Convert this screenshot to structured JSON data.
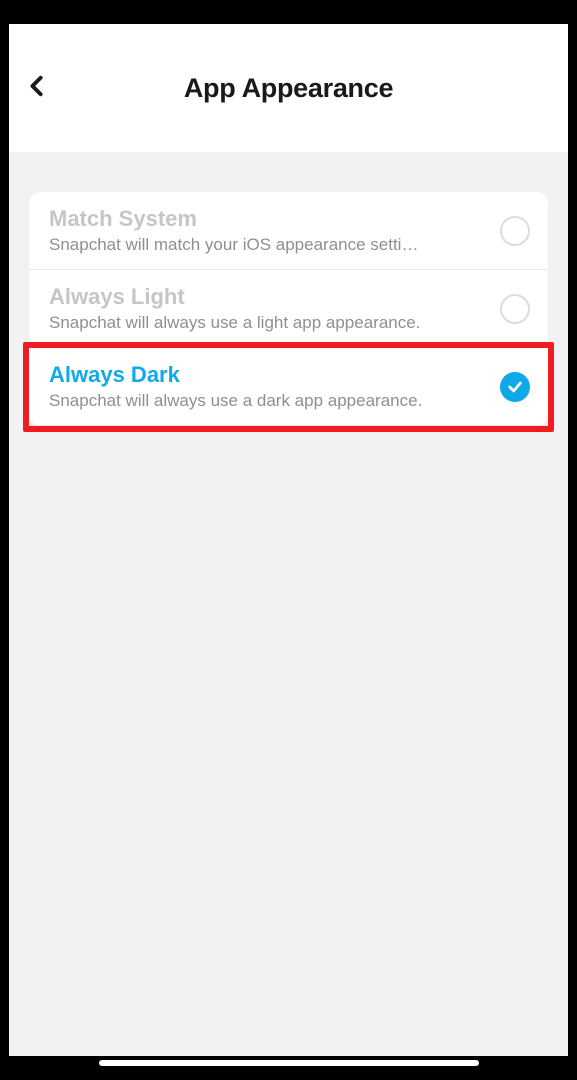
{
  "header": {
    "title": "App Appearance"
  },
  "options": [
    {
      "title": "Match System",
      "subtitle": "Snapchat will match your iOS appearance setti…",
      "selected": false
    },
    {
      "title": "Always Light",
      "subtitle": "Snapchat will always use a light app appearance.",
      "selected": false
    },
    {
      "title": "Always Dark",
      "subtitle": "Snapchat will always use a dark app appearance.",
      "selected": true
    }
  ],
  "highlight": {
    "index": 2
  }
}
